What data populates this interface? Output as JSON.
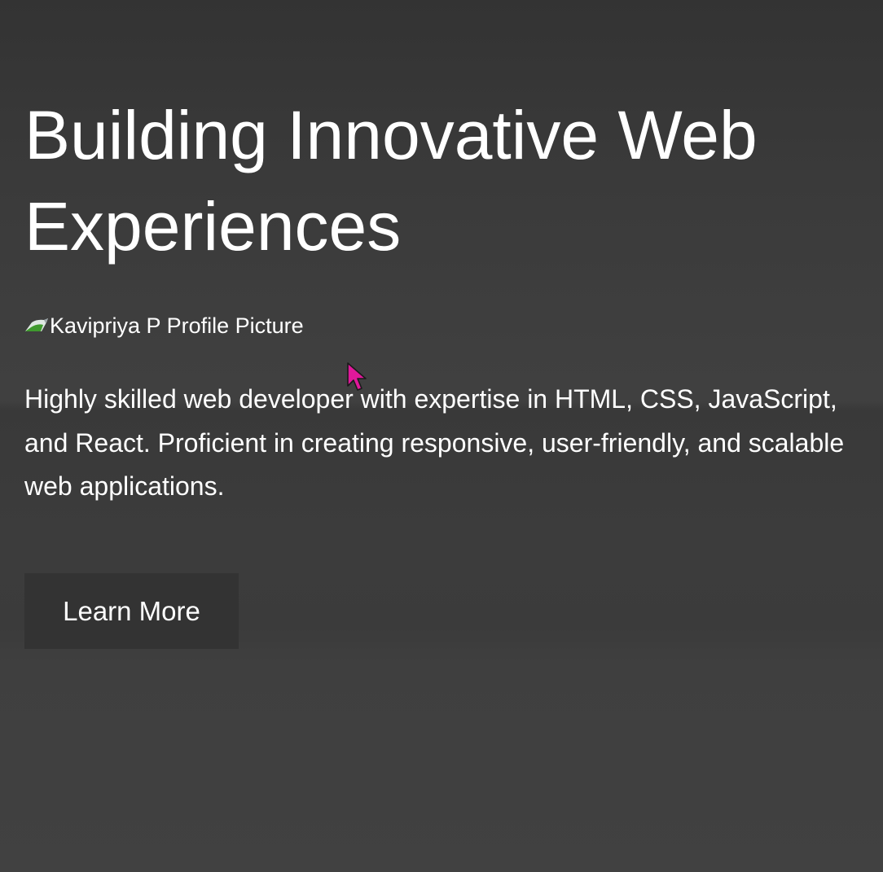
{
  "hero": {
    "title": "Building Innovative Web Experiences",
    "profile_image_alt": "Kavipriya P Profile Picture",
    "description": "Highly skilled web developer with expertise in HTML, CSS, JavaScript, and React. Proficient in creating responsive, user-friendly, and scalable web applications.",
    "cta_label": "Learn More"
  },
  "icons": {
    "profile_image": "broken-image-icon",
    "cursor": "mouse-pointer-icon"
  },
  "colors": {
    "background": "#3c3c3c",
    "text": "#ffffff",
    "button_background": "#333333",
    "cursor": "#e0189a"
  }
}
